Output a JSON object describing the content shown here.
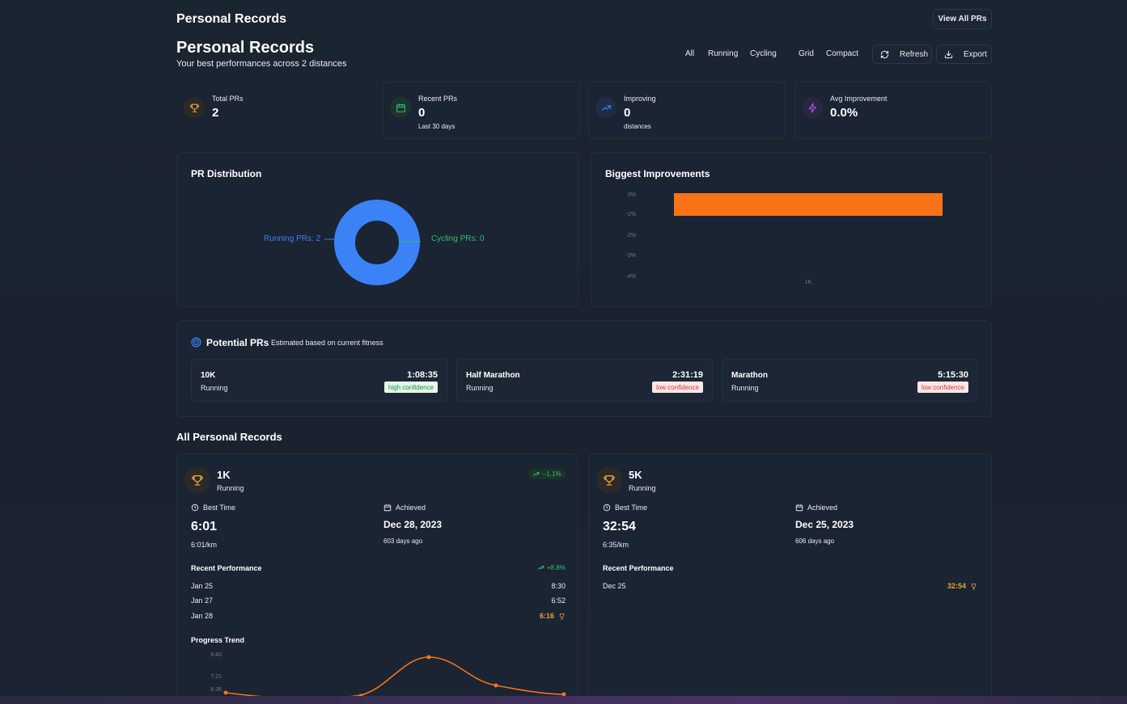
{
  "header": {
    "top_title": "Personal Records",
    "view_all_label": "View All PRs",
    "title": "Personal Records",
    "subtitle": "Your best performances across 2 distances"
  },
  "toolbar": {
    "filters": [
      "All",
      "Running",
      "Cycling"
    ],
    "views": [
      "Grid",
      "Compact"
    ],
    "refresh_label": "Refresh",
    "export_label": "Export"
  },
  "stats": [
    {
      "label": "Total PRs",
      "value": "2",
      "sub": "",
      "icon": "trophy-icon",
      "color": "#e8a23b"
    },
    {
      "label": "Recent PRs",
      "value": "0",
      "sub": "Last 30 days",
      "icon": "calendar-icon",
      "color": "#2fbf71"
    },
    {
      "label": "Improving",
      "value": "0",
      "sub": "distances",
      "icon": "trending-up-icon",
      "color": "#3b82f6"
    },
    {
      "label": "Avg Improvement",
      "value": "0.0%",
      "sub": "",
      "icon": "lightning-icon",
      "color": "#a855f7"
    }
  ],
  "distribution": {
    "title": "PR Distribution",
    "label_running": "Running PRs: 2",
    "label_cycling": "Cycling PRs: 0",
    "colors": {
      "running": "#3b82f6",
      "cycling": "#2fbf71"
    }
  },
  "improvements": {
    "title": "Biggest Improvements",
    "color": "#f97316"
  },
  "potential": {
    "title": "Potential PRs",
    "subtitle": "Estimated based on current fitness",
    "items": [
      {
        "name": "10K",
        "sport": "Running",
        "time": "1:08:35",
        "confidence": "high confidence",
        "level": "high"
      },
      {
        "name": "Half Marathon",
        "sport": "Running",
        "time": "2:31:19",
        "confidence": "low confidence",
        "level": "low"
      },
      {
        "name": "Marathon",
        "sport": "Running",
        "time": "5:15:30",
        "confidence": "low confidence",
        "level": "low"
      }
    ]
  },
  "records_title": "All Personal Records",
  "records": [
    {
      "distance": "1K",
      "sport": "Running",
      "trend": "--1.1%",
      "best_time_label": "Best Time",
      "best_time": "6:01",
      "pace": "6:01/km",
      "achieved_label": "Achieved",
      "achieved_date": "Dec 28, 2023",
      "days_ago": "603 days ago",
      "recent_title": "Recent Performance",
      "recent_trend": "+8.8%",
      "recent": [
        {
          "date": "Jan 25",
          "time": "8:30",
          "best": false
        },
        {
          "date": "Jan 27",
          "time": "6:52",
          "best": false
        },
        {
          "date": "Jan 28",
          "time": "6:16",
          "best": true
        }
      ],
      "progress_title": "Progress Trend"
    },
    {
      "distance": "5K",
      "sport": "Running",
      "best_time_label": "Best Time",
      "best_time": "32:54",
      "pace": "6:35/km",
      "achieved_label": "Achieved",
      "achieved_date": "Dec 25, 2023",
      "days_ago": "606 days ago",
      "recent_title": "Recent Performance",
      "recent": [
        {
          "date": "Dec 25",
          "time": "32:54",
          "best": true
        }
      ]
    }
  ],
  "chart_data": [
    {
      "type": "pie",
      "title": "PR Distribution",
      "labels": [
        "Running PRs",
        "Cycling PRs"
      ],
      "values": [
        2,
        0
      ]
    },
    {
      "type": "bar",
      "title": "Biggest Improvements",
      "categories": [
        "1K"
      ],
      "values": [
        -1.1
      ],
      "yticks": [
        "0%",
        "-1%",
        "-2%",
        "-3%",
        "-4%"
      ],
      "ylim": [
        -4,
        0
      ]
    },
    {
      "type": "line",
      "title": "Progress Trend",
      "yticks": [
        "8:40",
        "7:21",
        "6:36"
      ],
      "values_minutes": [
        6.6,
        6.3,
        8.5,
        6.9,
        6.3
      ]
    }
  ]
}
